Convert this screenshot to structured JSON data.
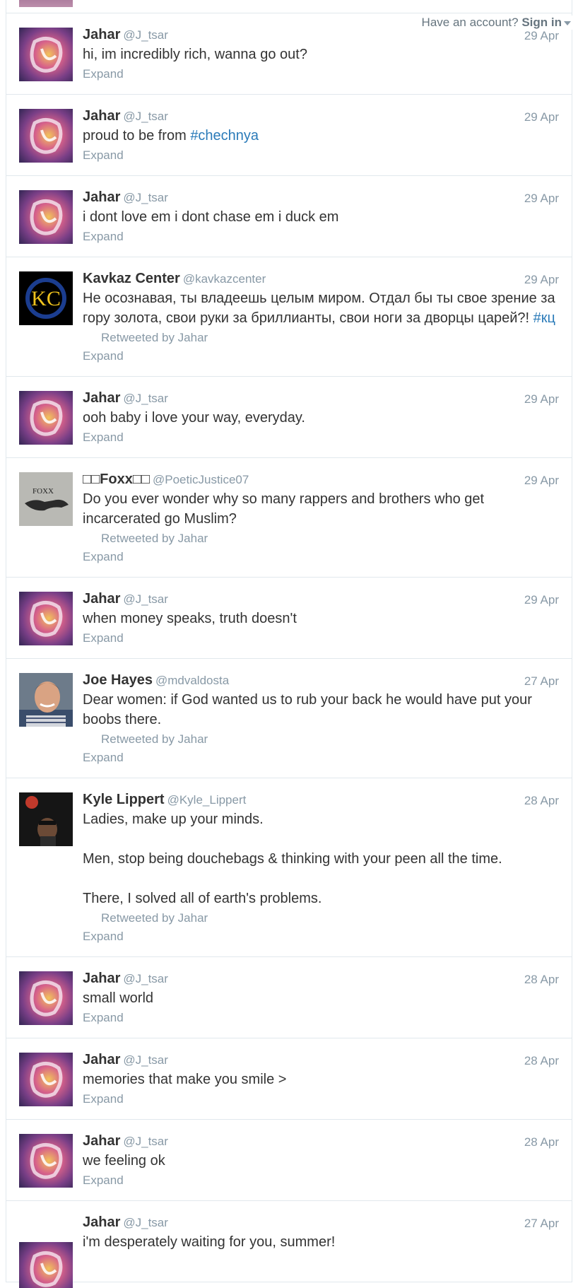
{
  "topbar": {
    "have_account": "Have an account?",
    "sign_in": "Sign in"
  },
  "tweets": [
    {
      "name": "Jahar",
      "handle": "@J_tsar",
      "date": "29 Apr",
      "text": "hi, im incredibly rich, wanna go out?",
      "avatar": "jahar",
      "expand": "Expand"
    },
    {
      "name": "Jahar",
      "handle": "@J_tsar",
      "date": "29 Apr",
      "text_pre": "proud to be from ",
      "hashtag": "#chechnya",
      "avatar": "jahar",
      "expand": "Expand"
    },
    {
      "name": "Jahar",
      "handle": "@J_tsar",
      "date": "29 Apr",
      "text": "i dont love em i dont chase em i duck em",
      "avatar": "jahar",
      "expand": "Expand"
    },
    {
      "name": "Kavkaz Center",
      "handle": "@kavkazcenter",
      "date": "29 Apr",
      "text_pre": "Не осознавая, ты владеешь целым миром. Отдал бы ты свое зрение за гору золота, свои руки за бриллианты, свои ноги за дворцы царей?! ",
      "hashtag": "#кц",
      "retweeted": "Retweeted by Jahar",
      "avatar": "kc",
      "avatar_text": "KC",
      "expand": "Expand"
    },
    {
      "name": "Jahar",
      "handle": "@J_tsar",
      "date": "29 Apr",
      "text": "ooh baby i love your way, everyday.",
      "avatar": "jahar",
      "expand": "Expand"
    },
    {
      "name": "□□Foxx□□",
      "handle": "@PoeticJustice07",
      "date": "29 Apr",
      "text": "Do you ever wonder why so many rappers and brothers who get incarcerated go Muslim?",
      "retweeted": "Retweeted by Jahar",
      "avatar": "foxx",
      "avatar_text": "FOXX",
      "expand": "Expand"
    },
    {
      "name": "Jahar",
      "handle": "@J_tsar",
      "date": "29 Apr",
      "text": "when money speaks, truth doesn't",
      "avatar": "jahar",
      "expand": "Expand"
    },
    {
      "name": "Joe Hayes",
      "handle": "@mdvaldosta",
      "date": "27 Apr",
      "text": "Dear women: if God wanted us to rub your back he would have put your boobs there.",
      "retweeted": "Retweeted by Jahar",
      "avatar": "joe",
      "expand": "Expand"
    },
    {
      "name": "Kyle Lippert",
      "handle": "@Kyle_Lippert",
      "date": "28 Apr",
      "text": "Ladies, make up your minds.\n\nMen, stop being douchebags & thinking with your peen all the time.\n\nThere, I solved all of earth's problems.",
      "retweeted": "Retweeted by Jahar",
      "avatar": "kyle",
      "expand": "Expand"
    },
    {
      "name": "Jahar",
      "handle": "@J_tsar",
      "date": "28 Apr",
      "text": "small world",
      "avatar": "jahar",
      "expand": "Expand"
    },
    {
      "name": "Jahar",
      "handle": "@J_tsar",
      "date": "28 Apr",
      "text": "memories that make you smile >",
      "avatar": "jahar",
      "expand": "Expand"
    },
    {
      "name": "Jahar",
      "handle": "@J_tsar",
      "date": "28 Apr",
      "text": "we feeling ok",
      "avatar": "jahar",
      "expand": "Expand"
    },
    {
      "name": "Jahar",
      "handle": "@J_tsar",
      "date": "27 Apr",
      "text": "i'm desperately waiting for you, summer!",
      "avatar": "jahar",
      "expand": ""
    }
  ]
}
